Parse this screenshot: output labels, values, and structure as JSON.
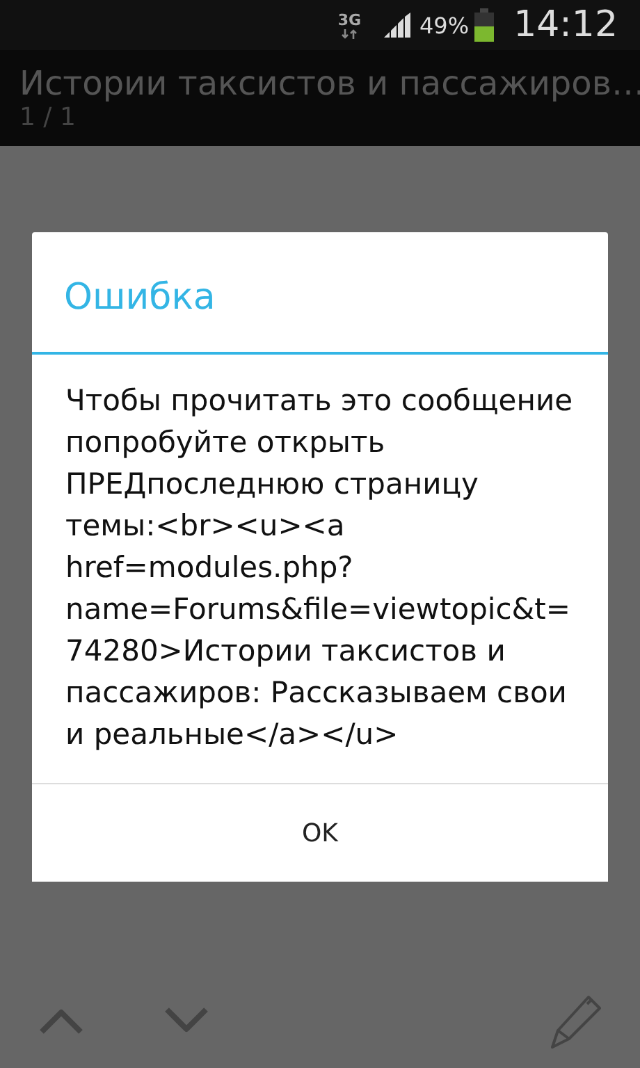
{
  "status_bar": {
    "network": "3G",
    "battery_percent": "49%",
    "time": "14:12"
  },
  "action_bar": {
    "title": "Истории таксистов и пассажиров…",
    "subtitle": "1 / 1"
  },
  "dialog": {
    "title": "Ошибка",
    "message": "Чтобы прочитать это сообщение попробуйте открыть ПРЕДпоследнюю страницу темы:<br><u><a href=modules.php?name=Forums&file=viewtopic&t=74280>Истории таксистов и пассажиров: Рассказываем свои и реальные</a></u>",
    "buttons": [
      "OK"
    ]
  }
}
